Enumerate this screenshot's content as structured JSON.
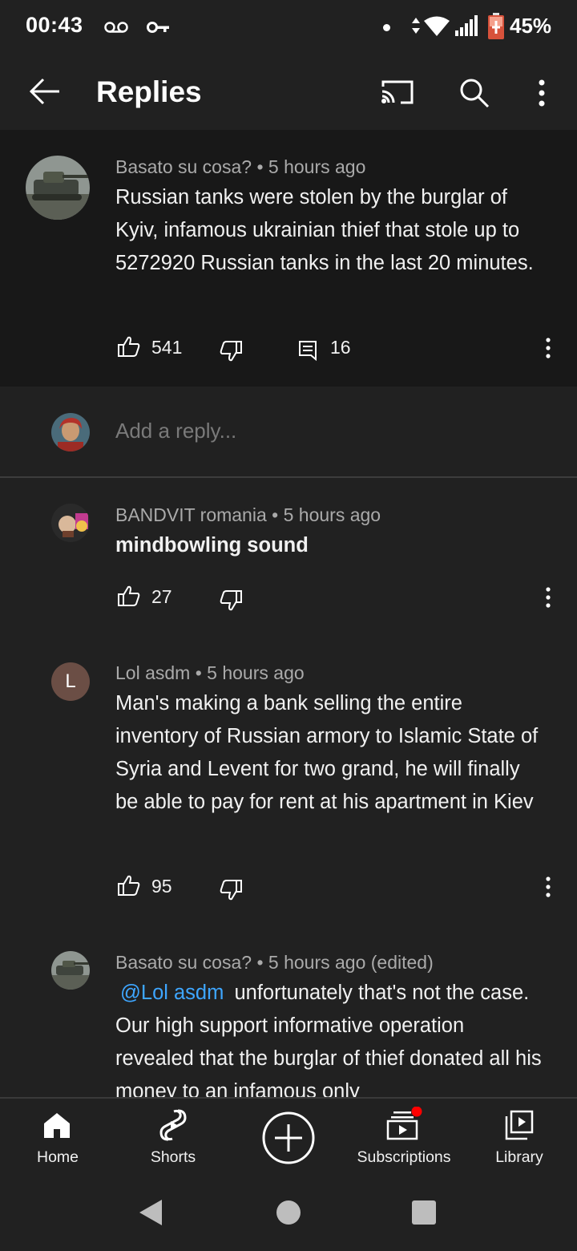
{
  "status_bar": {
    "time": "00:43",
    "battery_percent": "45%",
    "icons": [
      "voicemail-icon",
      "vpn-key-icon",
      "notification-dot-icon",
      "data-arrows-icon",
      "wifi-icon",
      "signal-icon",
      "battery-icon"
    ]
  },
  "app_bar": {
    "title": "Replies",
    "icons": [
      "back-arrow-icon",
      "cast-icon",
      "search-icon",
      "more-vert-icon"
    ]
  },
  "main_comment": {
    "author": "Basato su cosa?",
    "time": "5 hours ago",
    "text": "Russian tanks were stolen by the burglar of Kyiv, infamous ukrainian thief that stole up to 5272920 Russian tanks in the last 20 minutes.",
    "likes": "541",
    "replies": "16"
  },
  "reply_input": {
    "placeholder": "Add a reply..."
  },
  "replies": [
    {
      "author": "BANDVIT romania",
      "time": "5 hours ago",
      "text": "mindbowling sound",
      "likes": "27"
    },
    {
      "author": "Lol asdm",
      "avatar_letter": "L",
      "time": "5 hours ago",
      "text": "Man's making a bank selling the entire inventory of Russian armory to Islamic State of Syria and Levent for two grand, he will finally be able to pay for rent at his apartment in Kiev",
      "likes": "95"
    },
    {
      "author": "Basato su cosa?",
      "time": "5 hours ago (edited)",
      "mention": "@Lol asdm",
      "text": "unfortunately that's not the case. Our high support informative operation revealed that the burglar of thief donated all his money to an infamous only"
    }
  ],
  "bottom_nav": {
    "home": "Home",
    "shorts": "Shorts",
    "subscriptions": "Subscriptions",
    "library": "Library"
  },
  "colors": {
    "background": "#212121",
    "main_comment_bg": "#181818",
    "meta_text": "#aaaaaa",
    "mention": "#3ea6ff",
    "notification_dot": "#ff0000",
    "avatar_letter_bg": "#6b4e45"
  }
}
